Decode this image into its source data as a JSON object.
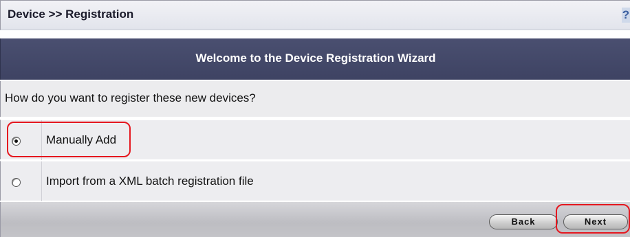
{
  "header": {
    "breadcrumb": "Device >> Registration",
    "help_label": "?"
  },
  "wizard": {
    "title": "Welcome to the Device Registration Wizard",
    "question": "How do you want to register these new devices?",
    "options": [
      {
        "label": "Manually Add",
        "selected": true
      },
      {
        "label": "Import from a XML batch registration file",
        "selected": false
      }
    ]
  },
  "footer": {
    "back_label": "Back",
    "next_label": "Next"
  },
  "colors": {
    "title_band": "#434869",
    "annotation": "#e5171f"
  }
}
